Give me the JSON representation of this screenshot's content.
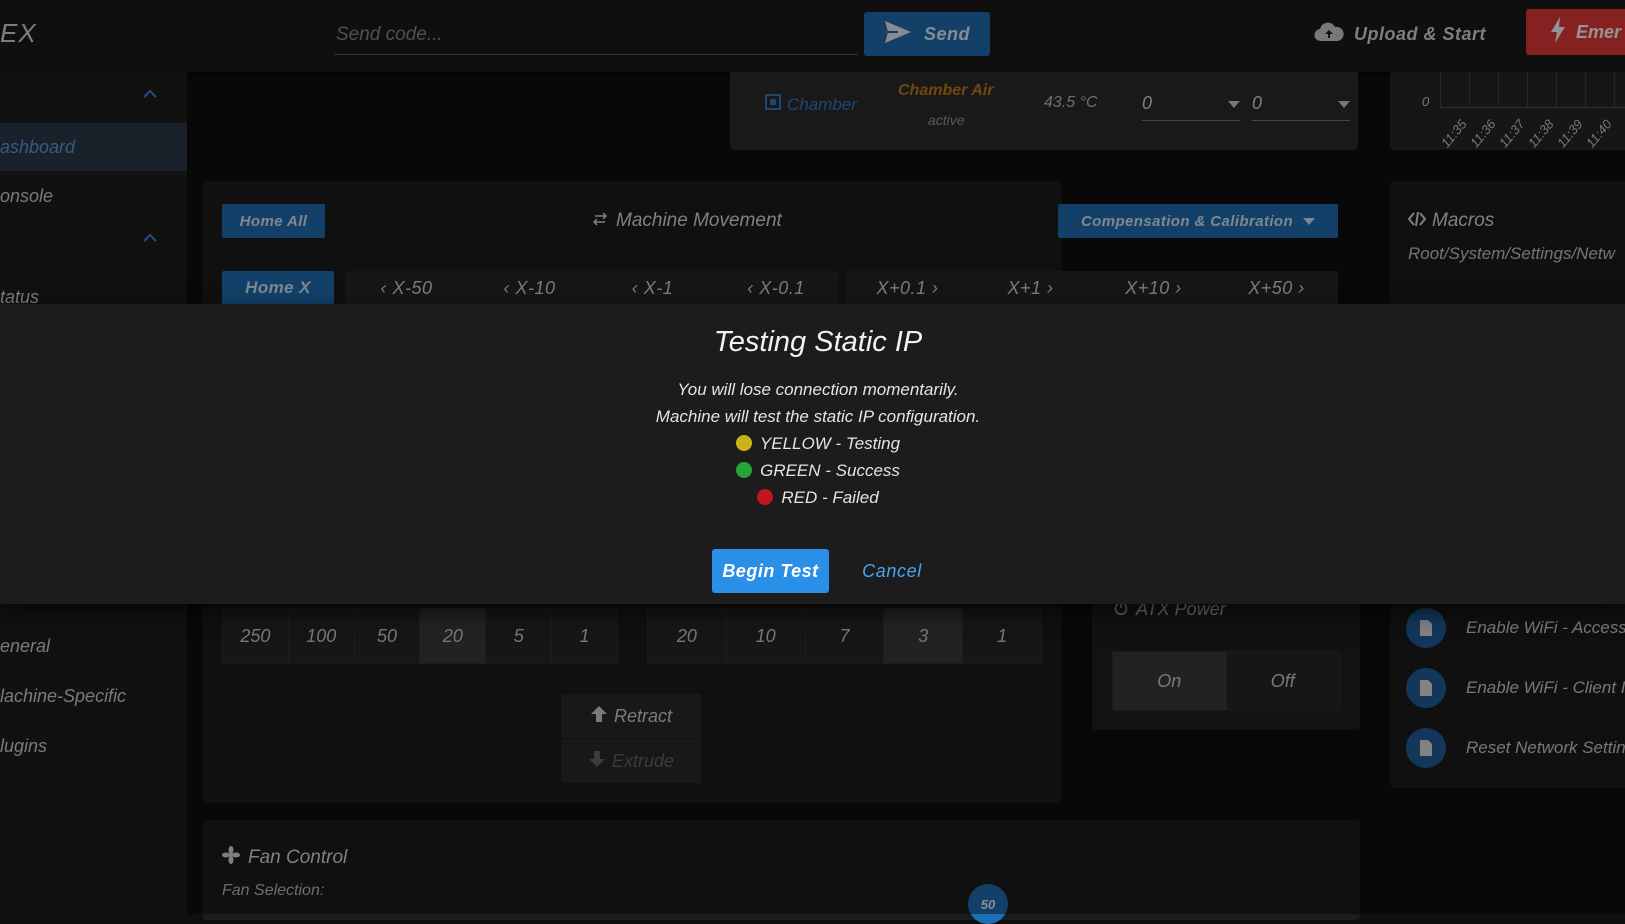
{
  "brand": "EX",
  "topbar": {
    "code_placeholder": "Send code...",
    "send_label": "Send",
    "upload_label": "Upload & Start",
    "emergency_label": "Emer"
  },
  "sidebar": {
    "items": [
      "ashboard",
      "onsole",
      "tatus",
      "eneral",
      "lachine-Specific",
      "lugins"
    ]
  },
  "chamber": {
    "name": "Chamber",
    "heater_name": "Chamber Air",
    "heater_state": "active",
    "current_temp": "43.5 °C",
    "active_value": "0",
    "standby_value": "0"
  },
  "temp_chart": {
    "y_tick": "0",
    "x_ticks": [
      "11:35",
      "11:36",
      "11:37",
      "11:38",
      "11:39",
      "11:40"
    ]
  },
  "movement": {
    "home_all": "Home All",
    "title": "Machine Movement",
    "comp_label": "Compensation & Calibration",
    "home_x": "Home X",
    "jog": [
      "X-50",
      "X-10",
      "X-1",
      "X-0.1",
      "X+0.1",
      "X+1",
      "X+10",
      "X+50"
    ],
    "amounts": [
      "250",
      "100",
      "50",
      "20",
      "5",
      "1"
    ],
    "amounts_selected": "20",
    "feedrates": [
      "20",
      "10",
      "7",
      "3",
      "1"
    ],
    "feedrates_selected": "3",
    "retract": "Retract",
    "extrude": "Extrude"
  },
  "atx": {
    "title": "ATX Power",
    "on": "On",
    "off": "Off"
  },
  "macros": {
    "title": "Macros",
    "path": "Root/System/Settings/Netw",
    "items": [
      "Enable WiFi - Access",
      "Enable WiFi - Client I",
      "Reset Network Settin"
    ]
  },
  "fan": {
    "title": "Fan Control",
    "selection_label": "Fan Selection:",
    "value_badge": "50"
  },
  "dialog": {
    "title": "Testing Static IP",
    "line1": "You will lose connection momentarily.",
    "line2": "Machine will test the static IP configuration.",
    "yellow": "YELLOW - Testing",
    "green": "GREEN - Success",
    "red": "RED - Failed",
    "begin": "Begin Test",
    "cancel": "Cancel"
  },
  "colors": {
    "accent": "#1f6fb4",
    "danger": "#e53a3a",
    "yellow": "#c9b317",
    "green": "#23a33a",
    "red": "#c0161e"
  }
}
